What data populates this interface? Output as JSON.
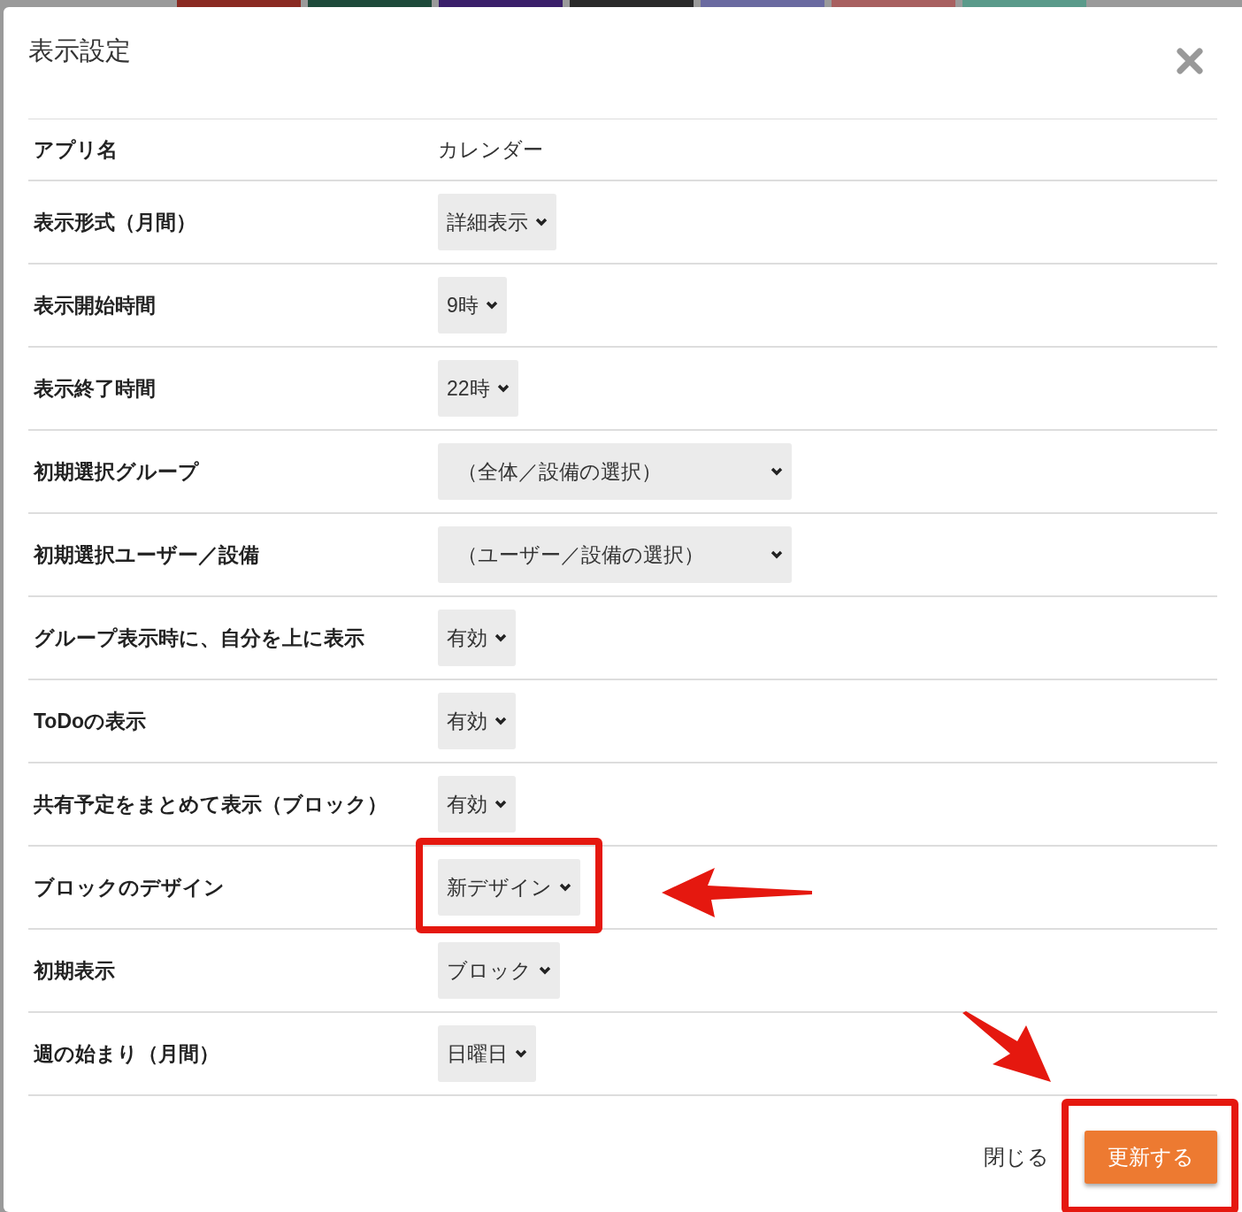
{
  "dialog": {
    "title": "表示設定"
  },
  "settings": [
    {
      "label": "アプリ名",
      "kind": "text",
      "value": "カレンダー",
      "highlighted": false
    },
    {
      "label": "表示形式（月間）",
      "kind": "select",
      "value": "詳細表示",
      "highlighted": false
    },
    {
      "label": "表示開始時間",
      "kind": "select",
      "value": "9時",
      "highlighted": false
    },
    {
      "label": "表示終了時間",
      "kind": "select",
      "value": "22時",
      "highlighted": false
    },
    {
      "label": "初期選択グループ",
      "kind": "wide-select",
      "value": "（全体／設備の選択）",
      "highlighted": false
    },
    {
      "label": "初期選択ユーザー／設備",
      "kind": "wide-select",
      "value": "（ユーザー／設備の選択）",
      "highlighted": false
    },
    {
      "label": "グループ表示時に、自分を上に表示",
      "kind": "select",
      "value": "有効",
      "highlighted": false
    },
    {
      "label": "ToDoの表示",
      "kind": "select",
      "value": "有効",
      "highlighted": false
    },
    {
      "label": "共有予定をまとめて表示（ブロック）",
      "kind": "select",
      "value": "有効",
      "highlighted": false
    },
    {
      "label": "ブロックのデザイン",
      "kind": "select",
      "value": "新デザイン",
      "highlighted": true
    },
    {
      "label": "初期表示",
      "kind": "select",
      "value": "ブロック",
      "highlighted": false
    },
    {
      "label": "週の始まり（月間）",
      "kind": "select",
      "value": "日曜日",
      "highlighted": false
    }
  ],
  "footer": {
    "close_label": "閉じる",
    "submit": {
      "label": "更新する",
      "highlighted": true
    }
  }
}
